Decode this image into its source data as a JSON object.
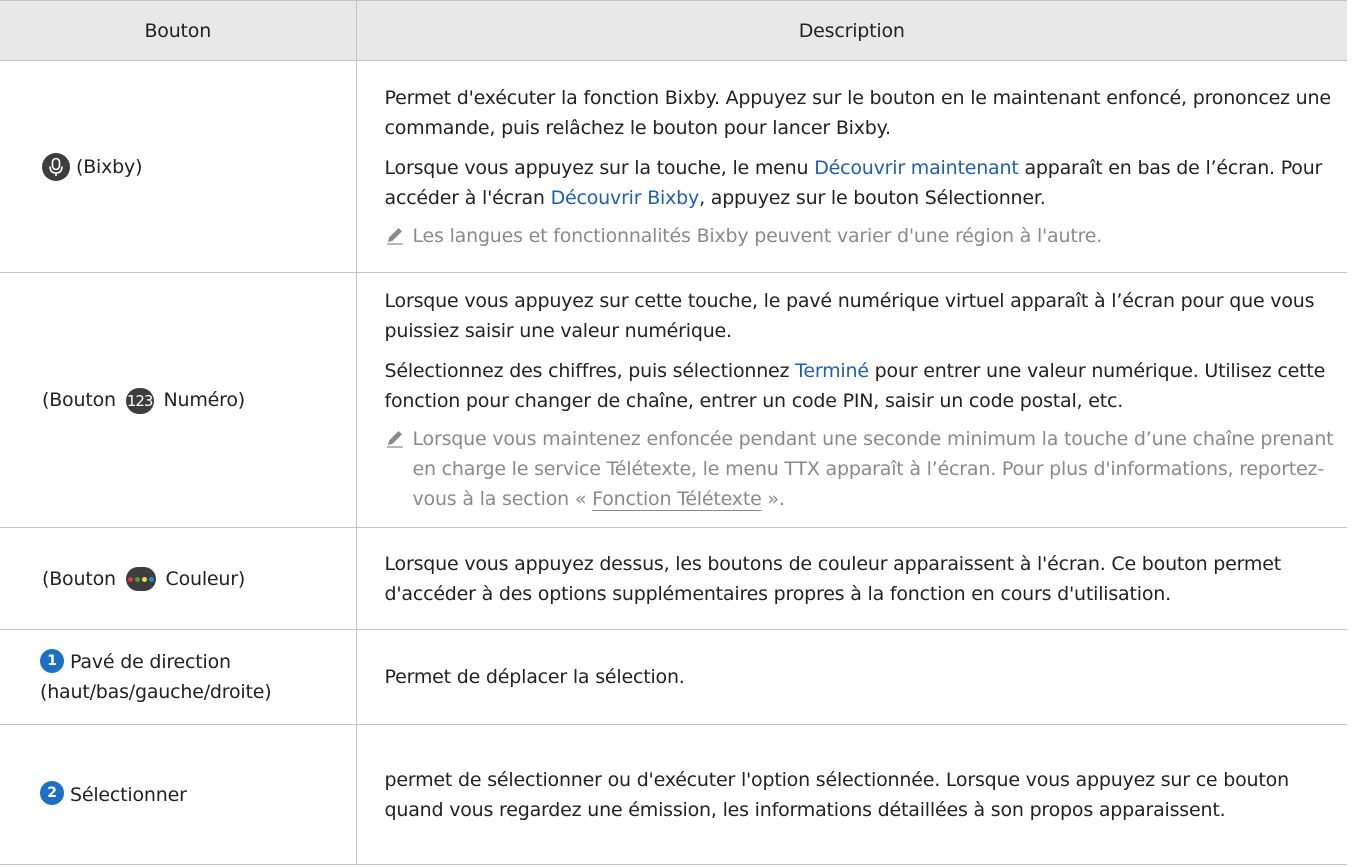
{
  "header": {
    "col_button": "Bouton",
    "col_description": "Description"
  },
  "rows": {
    "bixby": {
      "button_label": "(Bixby)",
      "icon": "microphone-icon",
      "para1": "Permet d'exécuter la fonction Bixby. Appuyez sur le bouton en le maintenant enfoncé, prononcez une commande, puis relâchez le bouton pour lancer Bixby.",
      "para2_a": "Lorsque vous appuyez sur la touche, le menu ",
      "para2_link1": "Découvrir maintenant",
      "para2_b": " apparaît en bas de l’écran. Pour accéder à l'écran ",
      "para2_link2": "Découvrir Bixby",
      "para2_c": ", appuyez sur le bouton Sélectionner.",
      "note": "Les langues et fonctionnalités Bixby peuvent varier d'une région à l'autre."
    },
    "number": {
      "label_prefix": "(Bouton ",
      "badge": "123",
      "label_suffix": " Numéro)",
      "para1": "Lorsque vous appuyez sur cette touche, le pavé numérique virtuel apparaît à l’écran pour que vous puissiez saisir une valeur numérique.",
      "para2_a": "Sélectionnez des chiffres, puis sélectionnez ",
      "para2_link": "Terminé",
      "para2_b": " pour entrer une valeur numérique. Utilisez cette fonction pour changer de chaîne, entrer un code PIN, saisir un code postal, etc.",
      "note_a": "Lorsque vous maintenez enfoncée pendant une seconde minimum la touche d’une chaîne prenant en charge le service Télétexte, le menu TTX apparaît à l’écran. Pour plus d'informations, reportez-vous à la section « ",
      "note_link": "Fonction Télétexte",
      "note_b": " »."
    },
    "color": {
      "label_prefix": "(Bouton ",
      "label_suffix": " Couleur)",
      "icon": "color-dots-icon",
      "dot_colors": [
        "#e53935",
        "#43a047",
        "#fdd835",
        "#1e88e5"
      ],
      "description": "Lorsque vous appuyez dessus, les boutons de couleur apparaissent à l'écran. Ce bouton permet d'accéder à des options supplémentaires propres à la fonction en cours d'utilisation."
    },
    "direction": {
      "number": "1",
      "label": "Pavé de direction (haut/bas/gauche/droite)",
      "description": "Permet de déplacer la sélection."
    },
    "select": {
      "number": "2",
      "label": "Sélectionner",
      "description": "permet de sélectionner ou d'exécuter l'option sélectionnée. Lorsque vous appuyez sur ce bouton quand vous regardez une émission, les informations détaillées à son propos apparaissent."
    }
  },
  "colors": {
    "header_bg": "#e8e8e8",
    "link": "#1d5fb4",
    "note_text": "#8a8a8a",
    "badge_bg": "#3d3d3d",
    "number_bg": "#1d6fc4",
    "border": "#c4c4c4"
  }
}
